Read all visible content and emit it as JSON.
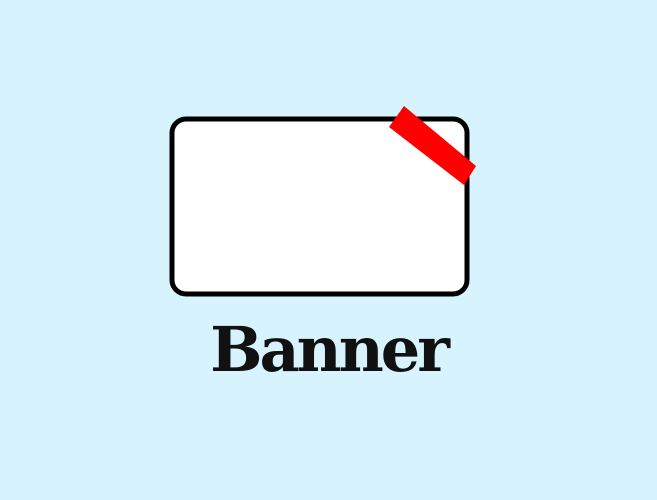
{
  "icon": {
    "name": "banner-icon",
    "colors": {
      "background": "#d7f4fe",
      "card_fill": "#ffffff",
      "card_stroke": "#000000",
      "ribbon": "#ff0000"
    }
  },
  "label": "Banner"
}
